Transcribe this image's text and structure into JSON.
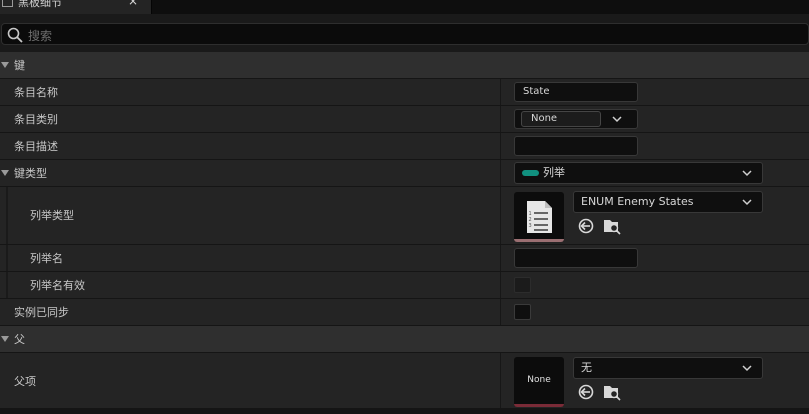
{
  "tab": {
    "title": "黑板细节",
    "close": "×",
    "icon": "blackboard-tab-icon",
    "close_icon": "close-icon"
  },
  "search": {
    "placeholder": "搜索",
    "icon": "search-icon"
  },
  "sections": {
    "key": {
      "label": "键"
    },
    "parent": {
      "label": "父"
    }
  },
  "fields": {
    "entry_name": {
      "label": "条目名称",
      "value": "State"
    },
    "entry_category": {
      "label": "条目类别",
      "value": "None"
    },
    "entry_description": {
      "label": "条目描述",
      "value": ""
    },
    "key_type": {
      "label": "键类型",
      "value": "列举"
    },
    "enum_type": {
      "label": "列举类型",
      "value": "ENUM Enemy States"
    },
    "enum_name": {
      "label": "列举名",
      "value": ""
    },
    "enum_name_valid": {
      "label": "列举名有效",
      "checked": false
    },
    "instance_synced": {
      "label": "实例已同步",
      "checked": false
    },
    "parent_item": {
      "label": "父项",
      "value": "无",
      "thumb": "None"
    }
  },
  "colors": {
    "enum_accent": "#11907f",
    "thumb_bar": "#7a2b37"
  }
}
